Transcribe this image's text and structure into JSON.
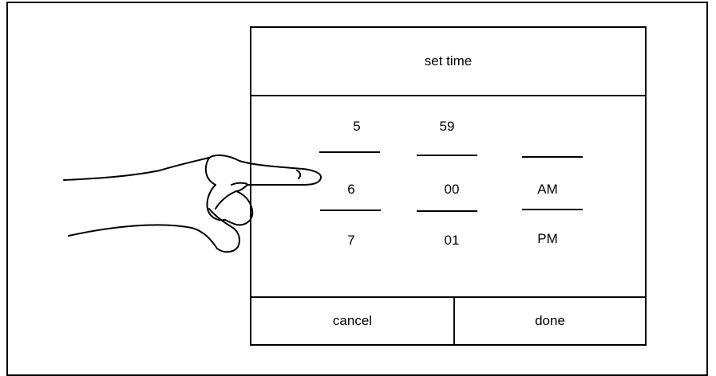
{
  "dialog": {
    "title": "set time",
    "cancel_label": "cancel",
    "done_label": "done"
  },
  "picker": {
    "hour": {
      "prev": "5",
      "selected": "6",
      "next": "7"
    },
    "minute": {
      "prev": "59",
      "selected": "00",
      "next": "01"
    },
    "period": {
      "selected": "AM",
      "next": "PM"
    }
  }
}
